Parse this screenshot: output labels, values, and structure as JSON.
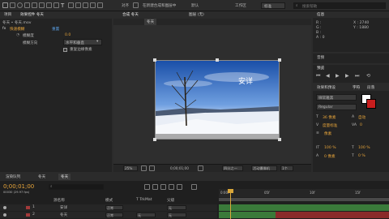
{
  "toolbar": {
    "label_text": "对齐",
    "layer_label": "在新建合成和图层中",
    "default_label": "默认",
    "workspace_label": "工作区",
    "workspace_value": "标准",
    "search_placeholder": "搜索帮助"
  },
  "left_panel": {
    "tabs": [
      "项目",
      "效果控件 冬天"
    ],
    "comp_path": "冬天 • 冬天.mov",
    "effect_name": "快速模糊",
    "reset_label": "重置",
    "prop_blur": "模糊度",
    "prop_blur_value": "0.0",
    "prop_dim": "模糊方向",
    "prop_dim_value": "水平和垂直",
    "repeat_label": "重复边缘像素"
  },
  "comp_viewer": {
    "tabs": [
      "合成 冬天",
      "图层 (无)"
    ],
    "sub_tab": "冬天",
    "watermark": "安详",
    "zoom": "25%",
    "timecode": "0;00;01;00",
    "quality": "四分之一",
    "camera": "活动摄像机",
    "views": "1个"
  },
  "info_panel": {
    "tab": "信息",
    "r": "R :",
    "g": "G :",
    "b": "B :",
    "a": "A : 0",
    "x": "X : 2740",
    "y": "Y : 1880"
  },
  "audio_panel": {
    "tab": "音频"
  },
  "preview_panel": {
    "tab": "预览",
    "tab2": "效果和预设"
  },
  "character_panel": {
    "tab": "字符",
    "tab2": "段落",
    "font": "微软雅黑",
    "style": "Regular",
    "size": "36 像素",
    "leading": "自动",
    "kerning": "度量标准",
    "tracking": "0",
    "stroke": "像素",
    "vscale": "100 %",
    "hscale": "100 %",
    "baseline": "0 像素",
    "tsume": "0 %"
  },
  "timeline": {
    "tabs": [
      "渲染队列",
      "冬天",
      "冬天"
    ],
    "timecode": "0;00;01;00",
    "fps": "00030 (29.97 fps)",
    "col_source": "源名称",
    "col_mode": "模式",
    "col_trkmat": "T TrkMat",
    "col_parent": "父级",
    "ruler": [
      "0:00f",
      "05f",
      "10f",
      "15f"
    ],
    "layers": [
      {
        "num": "1",
        "name": "安详",
        "mode": "正常",
        "parent": "无"
      },
      {
        "num": "2",
        "name": "冬天",
        "mode": "正常",
        "parent": "无"
      }
    ],
    "trkmat_value": "无"
  },
  "colors": {
    "accent_orange": "#e6a43a",
    "accent_blue": "#5aa2e8",
    "playhead": "#d9a63a",
    "bar_green": "#3a7a3a",
    "bar_red": "#8a2a2a"
  }
}
